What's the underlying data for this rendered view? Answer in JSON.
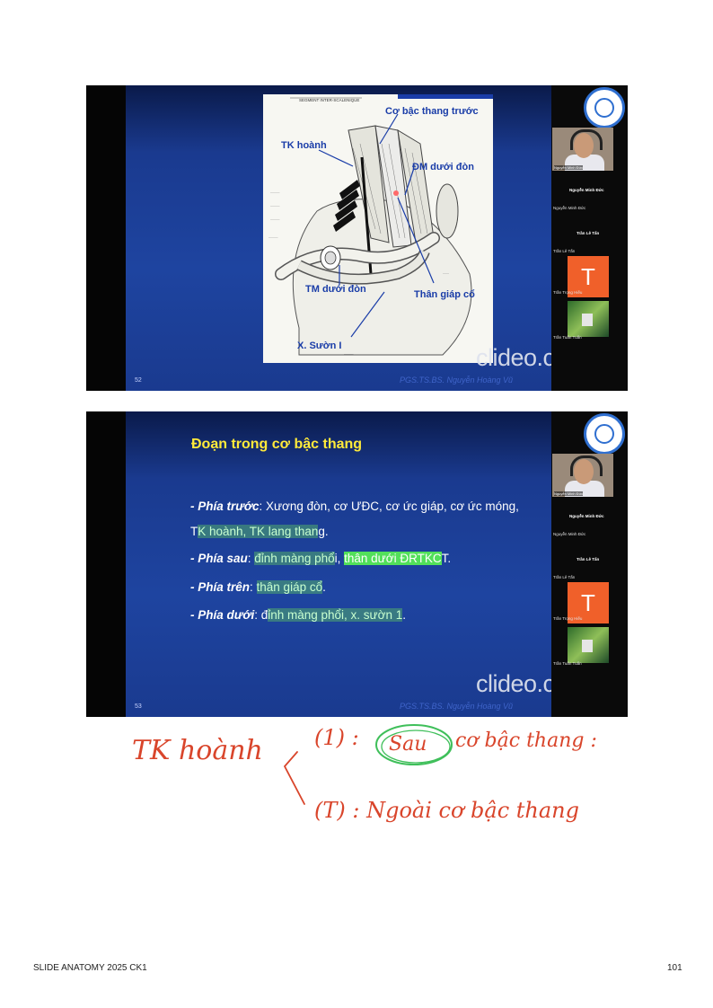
{
  "slide1": {
    "number": "52",
    "credit": "PGS.TS.BS. Nguyễn Hoàng Vũ",
    "watermark": "clideo.com",
    "diagram_header": "SEGMENT INTER-SCALENIQUE",
    "labels": {
      "co_bac_thang_truoc": "Cơ bậc thang trước",
      "tk_hoanh": "TK hoành",
      "dm_duoi_don": "ĐM dưới đòn",
      "tm_duoi_don": "TM dưới đòn",
      "than_giap_co": "Thân giáp cổ",
      "x_suon_1": "X. Sườn I"
    }
  },
  "slide2": {
    "number": "53",
    "credit": "PGS.TS.BS. Nguyễn Hoàng Vũ",
    "watermark": "clideo.com",
    "title": "Đoạn trong cơ bậc thang",
    "line1_label": "- Phía trước",
    "line1_text": ": Xương đòn, cơ ƯĐC, cơ ức giáp, cơ ức móng,",
    "line2_a": "T",
    "line2_hl": "K hoành, TK lang than",
    "line2_b": "g.",
    "line3_label": "- Phía sau",
    "line3_a": ": ",
    "line3_hl1": "đỉnh màng phổ",
    "line3_b": "i, ",
    "line3_hl2": "thân dưới ĐRTKC",
    "line3_c": "T.",
    "line4_label": "- Phía trên",
    "line4_a": ": ",
    "line4_hl": "thân giáp cổ",
    "line4_b": ".",
    "line5_label": "- Phía dưới",
    "line5_a": ": đ",
    "line5_hl": "ỉnh màng phổi, x. sườn 1",
    "line5_b": "."
  },
  "participants": {
    "video_name": "Nguyễn Minh Đức",
    "p1_bold": "Nguyễn Minh Đức",
    "p1": "Nguyễn Minh Đức",
    "p2_bold": "Trần Lê Tấn",
    "p2": "Trần Lê Tấn",
    "avatar_letter": "T",
    "p3": "Trần Trọng Hiếu",
    "p4": "Trần Tuấn Tuấn"
  },
  "handwriting": {
    "left": "TK hoành",
    "line1_marker": "(1) :",
    "line1_circled": "Sau",
    "line1_rest": "cơ bậc thang :",
    "line2": "(T) : Ngoài cơ bậc thang"
  },
  "footer": {
    "left": "SLIDE ANATOMY 2025 CK1",
    "page": "101"
  },
  "colors": {
    "slide_blue": "#1e44a0",
    "title_yellow": "#ffea3a",
    "label_blue": "#1a3da8",
    "ink_red": "#d9452b",
    "ink_green": "#3fbf5a"
  }
}
